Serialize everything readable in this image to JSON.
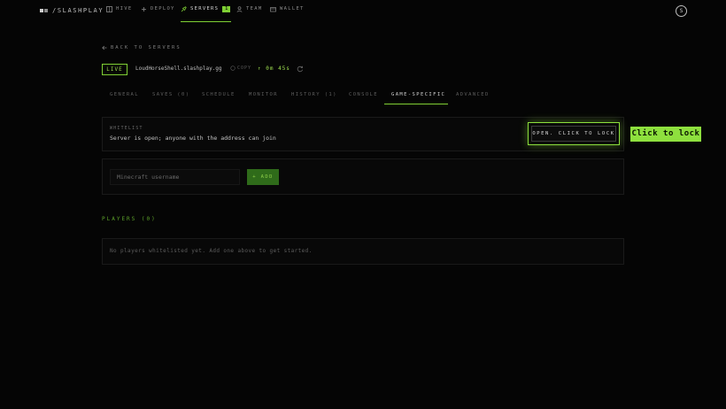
{
  "nav": {
    "brand": "/SLASHPLAY",
    "items": [
      {
        "label": "HIVE",
        "icon": "grid-icon"
      },
      {
        "label": "DEPLOY",
        "icon": "plus-icon"
      },
      {
        "label": "SERVERS",
        "icon": "rocket-icon",
        "badge": "1"
      },
      {
        "label": "TEAM",
        "icon": "people-icon"
      },
      {
        "label": "WALLET",
        "icon": "wallet-icon"
      }
    ],
    "avatar": "S"
  },
  "back_label": "BACK TO SERVERS",
  "server": {
    "status": "LIVE",
    "host": "LoudHorseShell.slashplay.gg",
    "copy_label": "COPY",
    "uptime": "0m 45s"
  },
  "tabs": [
    "GENERAL",
    "SAVES (0)",
    "SCHEDULE",
    "MONITOR",
    "HISTORY (1)",
    "CONSOLE",
    "GAME-SPECIFIC",
    "ADVANCED"
  ],
  "active_tab": "GAME-SPECIFIC",
  "whitelist": {
    "label": "WHITELIST",
    "description": "Server is open; anyone with the address can join",
    "button": "OPEN. CLICK TO LOCK",
    "tooltip": "Click to lock"
  },
  "add_player": {
    "placeholder": "Minecraft username",
    "button": "+ ADD"
  },
  "players": {
    "heading": "PLAYERS (0)",
    "empty": "No players whitelisted yet. Add one above to get started."
  },
  "colors": {
    "accent": "#7fd034",
    "background": "#050505"
  }
}
